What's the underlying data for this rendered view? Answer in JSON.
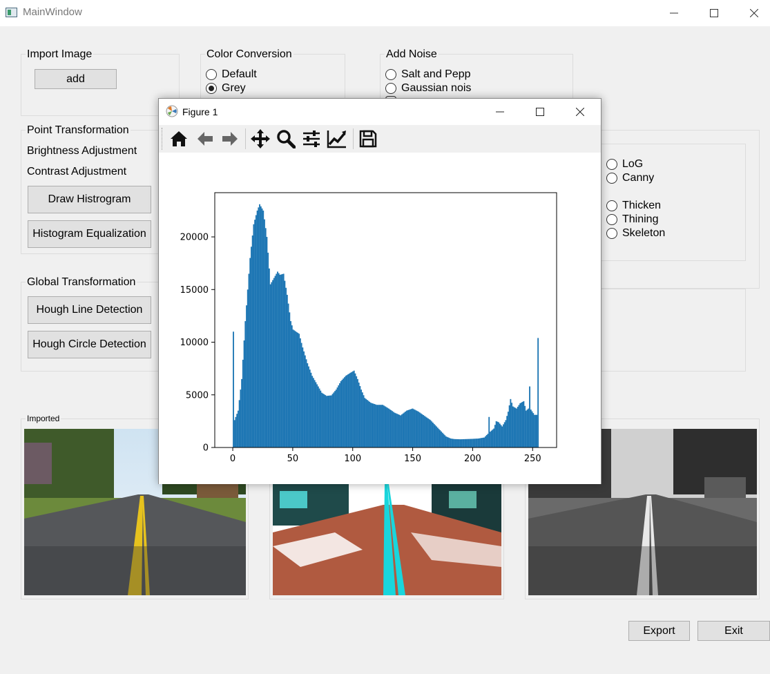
{
  "window": {
    "title": "MainWindow"
  },
  "import_group": {
    "title": "Import Image",
    "add_label": "add"
  },
  "color_group": {
    "title": "Color Conversion",
    "options": [
      {
        "label": "Default",
        "checked": false
      },
      {
        "label": "Grey",
        "checked": true
      }
    ]
  },
  "noise_group": {
    "title": "Add Noise",
    "options": [
      {
        "label": "Salt and Pepp",
        "checked": false
      },
      {
        "label": "Gaussian nois",
        "checked": false
      }
    ]
  },
  "point_group": {
    "title": "Point Transformation",
    "brightness_label": "Brightness Adjustment",
    "contrast_label": "Contrast Adjustment",
    "draw_histogram_label": "Draw Histrogram",
    "equalization_label": "Histogram Equalization"
  },
  "global_group": {
    "title": "Global Transformation",
    "hough_line_label": "Hough Line Detection",
    "hough_circle_label": "Hough Circle Detection"
  },
  "edge_group": {
    "options": [
      {
        "label": "LoG",
        "checked": false
      },
      {
        "label": "Canny",
        "checked": false
      },
      {
        "label": "Thicken",
        "checked": false
      },
      {
        "label": "Thining",
        "checked": false
      },
      {
        "label": "Skeleton",
        "checked": false
      }
    ]
  },
  "image_panels": {
    "imported_title": "Imported"
  },
  "actions": {
    "export_label": "Export",
    "exit_label": "Exit"
  },
  "figure": {
    "title": "Figure 1",
    "toolbar_icons": [
      "home-icon",
      "back-arrow-icon",
      "forward-arrow-icon",
      "pan-icon",
      "zoom-icon",
      "configure-subplots-icon",
      "edit-axes-icon",
      "save-icon"
    ]
  },
  "colors": {
    "bar": "#1f77b4",
    "accent": "#e1e1e1"
  },
  "chart_data": {
    "type": "bar",
    "title": "",
    "xlabel": "",
    "ylabel": "",
    "xlim": [
      -15,
      270
    ],
    "ylim": [
      0,
      24200
    ],
    "xticks": [
      0,
      50,
      100,
      150,
      200,
      250
    ],
    "yticks": [
      0,
      5000,
      10000,
      15000,
      20000
    ],
    "bins": 256,
    "bin_range": [
      0,
      255
    ],
    "profile_keypoints": [
      [
        0,
        11000
      ],
      [
        1,
        2600
      ],
      [
        4,
        3500
      ],
      [
        7,
        6500
      ],
      [
        10,
        12000
      ],
      [
        14,
        18000
      ],
      [
        17,
        21200
      ],
      [
        20,
        22500
      ],
      [
        22,
        23100
      ],
      [
        25,
        22500
      ],
      [
        28,
        20000
      ],
      [
        31,
        15500
      ],
      [
        34,
        16100
      ],
      [
        37,
        16700
      ],
      [
        39,
        16400
      ],
      [
        42,
        16500
      ],
      [
        45,
        14500
      ],
      [
        48,
        12000
      ],
      [
        50,
        11200
      ],
      [
        55,
        10800
      ],
      [
        58,
        9500
      ],
      [
        62,
        8000
      ],
      [
        66,
        6800
      ],
      [
        70,
        6000
      ],
      [
        74,
        5200
      ],
      [
        78,
        4900
      ],
      [
        82,
        4950
      ],
      [
        86,
        5500
      ],
      [
        90,
        6300
      ],
      [
        94,
        6800
      ],
      [
        98,
        7100
      ],
      [
        101,
        7300
      ],
      [
        104,
        6500
      ],
      [
        107,
        5500
      ],
      [
        110,
        4700
      ],
      [
        115,
        4250
      ],
      [
        120,
        4050
      ],
      [
        125,
        4050
      ],
      [
        130,
        3700
      ],
      [
        135,
        3300
      ],
      [
        140,
        3050
      ],
      [
        145,
        3500
      ],
      [
        150,
        3700
      ],
      [
        155,
        3400
      ],
      [
        160,
        3000
      ],
      [
        165,
        2600
      ],
      [
        170,
        2000
      ],
      [
        175,
        1400
      ],
      [
        178,
        1050
      ],
      [
        182,
        850
      ],
      [
        185,
        800
      ],
      [
        190,
        780
      ],
      [
        195,
        800
      ],
      [
        200,
        820
      ],
      [
        205,
        850
      ],
      [
        210,
        950
      ],
      [
        213,
        1300
      ],
      [
        214,
        2900
      ],
      [
        215,
        1500
      ],
      [
        218,
        1800
      ],
      [
        220,
        2500
      ],
      [
        222,
        2400
      ],
      [
        225,
        2000
      ],
      [
        228,
        2600
      ],
      [
        230,
        3400
      ],
      [
        232,
        4600
      ],
      [
        234,
        3900
      ],
      [
        237,
        3700
      ],
      [
        240,
        4200
      ],
      [
        243,
        4400
      ],
      [
        245,
        3500
      ],
      [
        247,
        3700
      ],
      [
        248,
        5800
      ],
      [
        249,
        3600
      ],
      [
        252,
        3100
      ],
      [
        254,
        3100
      ],
      [
        255,
        10400
      ]
    ]
  }
}
